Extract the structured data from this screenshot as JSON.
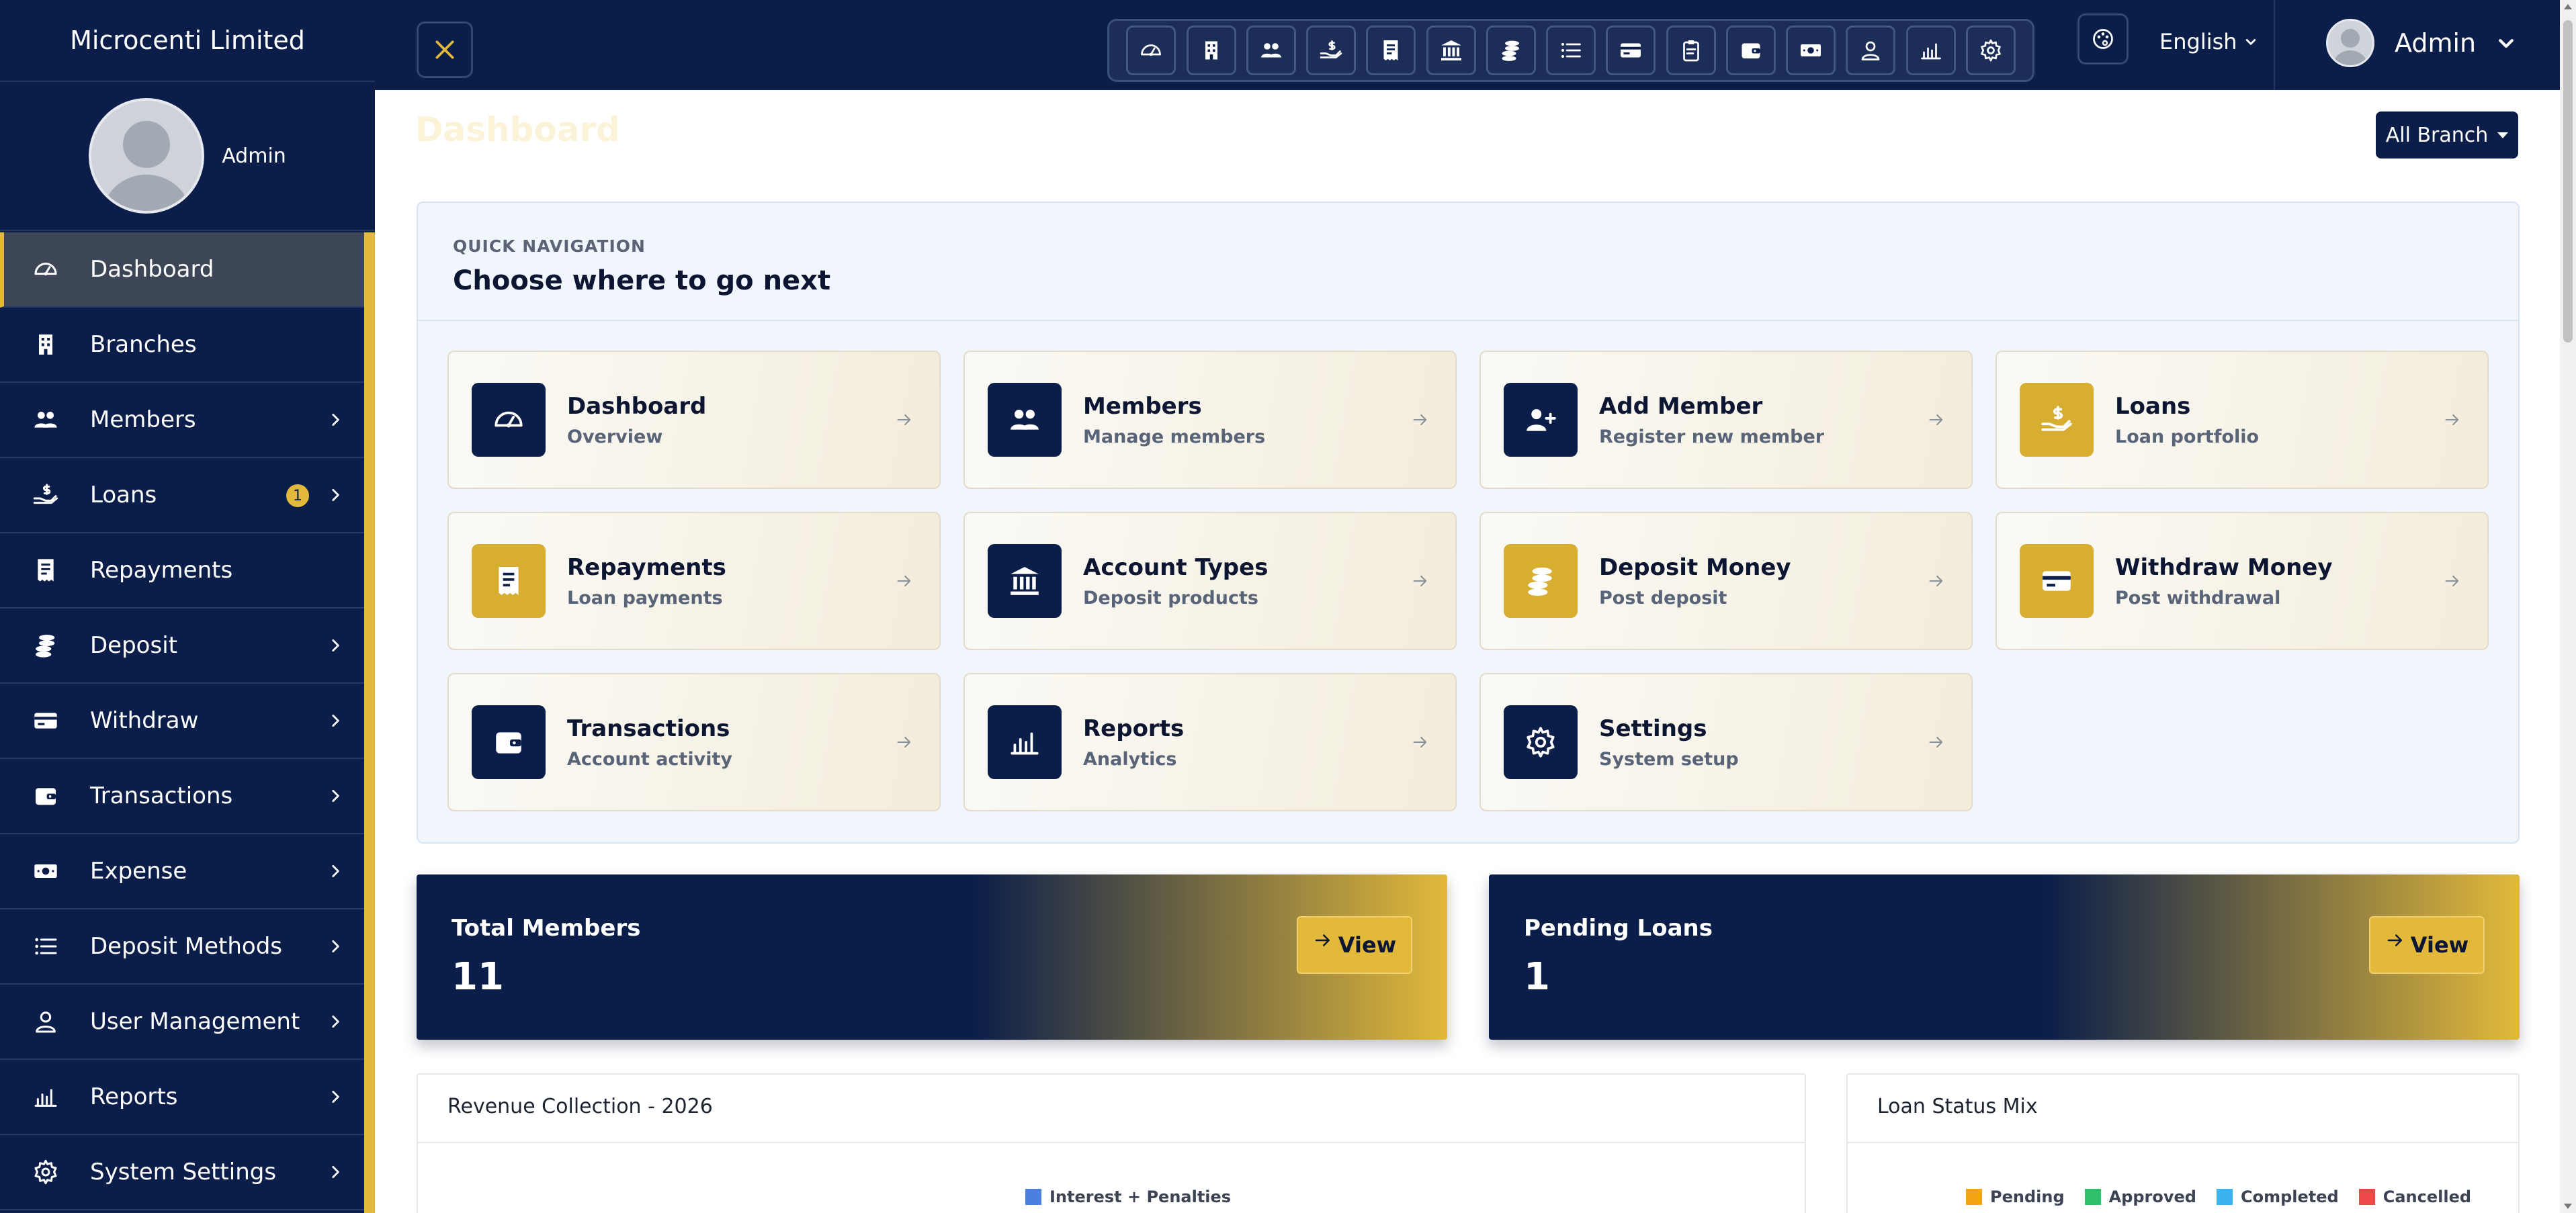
{
  "brand": "Microcenti Limited",
  "sidebar": {
    "username": "Admin",
    "items": [
      {
        "label": "Dashboard",
        "icon": "dashboard-gauge-icon",
        "active": true
      },
      {
        "label": "Branches",
        "icon": "building-icon"
      },
      {
        "label": "Members",
        "icon": "users-icon",
        "chevron": true
      },
      {
        "label": "Loans",
        "icon": "hand-dollar-icon",
        "chevron": true,
        "badge": "1"
      },
      {
        "label": "Repayments",
        "icon": "receipt-icon"
      },
      {
        "label": "Deposit",
        "icon": "coins-icon",
        "chevron": true
      },
      {
        "label": "Withdraw",
        "icon": "card-icon",
        "chevron": true
      },
      {
        "label": "Transactions",
        "icon": "wallet-icon",
        "chevron": true
      },
      {
        "label": "Expense",
        "icon": "money-icon",
        "chevron": true
      },
      {
        "label": "Deposit Methods",
        "icon": "list-icon",
        "chevron": true
      },
      {
        "label": "User Management",
        "icon": "user-icon",
        "chevron": true
      },
      {
        "label": "Reports",
        "icon": "bar-chart-icon",
        "chevron": true
      },
      {
        "label": "System Settings",
        "icon": "gear-icon",
        "chevron": true
      }
    ]
  },
  "topbar": {
    "shortcuts": [
      "dashboard-gauge-icon",
      "building-icon",
      "users-icon",
      "hand-dollar-icon",
      "receipt-icon",
      "bank-icon",
      "coins-icon",
      "list-icon",
      "card-icon",
      "clipboard-icon",
      "wallet-icon",
      "money-icon",
      "user-icon",
      "bar-chart-icon",
      "gear-icon"
    ],
    "language": "English",
    "user": "Admin"
  },
  "page": {
    "title": "Dashboard",
    "branch_filter": "All Branch"
  },
  "quick_nav": {
    "subtitle": "QUICK NAVIGATION",
    "title": "Choose where to go next",
    "cards": [
      {
        "name": "Dashboard",
        "desc": "Overview",
        "icon": "dashboard-gauge-icon",
        "color": "#0b1e49"
      },
      {
        "name": "Members",
        "desc": "Manage members",
        "icon": "users-icon",
        "color": "#0b1e49"
      },
      {
        "name": "Add Member",
        "desc": "Register new member",
        "icon": "user-plus-icon",
        "color": "#0b1e49"
      },
      {
        "name": "Loans",
        "desc": "Loan portfolio",
        "icon": "hand-dollar-icon",
        "color": "#d7ae32"
      },
      {
        "name": "Repayments",
        "desc": "Loan payments",
        "icon": "receipt-icon",
        "color": "#d7ae32"
      },
      {
        "name": "Account Types",
        "desc": "Deposit products",
        "icon": "bank-icon",
        "color": "#0b1e49"
      },
      {
        "name": "Deposit Money",
        "desc": "Post deposit",
        "icon": "coins-icon",
        "color": "#d7ae32"
      },
      {
        "name": "Withdraw Money",
        "desc": "Post withdrawal",
        "icon": "card-icon",
        "color": "#d7ae32"
      },
      {
        "name": "Transactions",
        "desc": "Account activity",
        "icon": "wallet-icon",
        "color": "#0b1e49"
      },
      {
        "name": "Reports",
        "desc": "Analytics",
        "icon": "bar-chart-icon",
        "color": "#0b1e49"
      },
      {
        "name": "Settings",
        "desc": "System setup",
        "icon": "gear-icon",
        "color": "#0b1e49"
      }
    ]
  },
  "stats": [
    {
      "label": "Total Members",
      "value": "11",
      "button": "View"
    },
    {
      "label": "Pending Loans",
      "value": "1",
      "button": "View"
    }
  ],
  "revenue_panel": {
    "title": "Revenue Collection - 2026",
    "legend": [
      {
        "name": "Interest + Penalties",
        "color": "#4a7fe0"
      }
    ]
  },
  "loan_status_panel": {
    "title": "Loan Status Mix",
    "legend": [
      {
        "name": "Pending",
        "color": "#f2a413"
      },
      {
        "name": "Approved",
        "color": "#2fc16a"
      },
      {
        "name": "Completed",
        "color": "#39b4ee"
      },
      {
        "name": "Cancelled",
        "color": "#ec4848"
      }
    ]
  },
  "theme": {
    "navy": "#0b1e49",
    "gold": "#e2b93b"
  }
}
